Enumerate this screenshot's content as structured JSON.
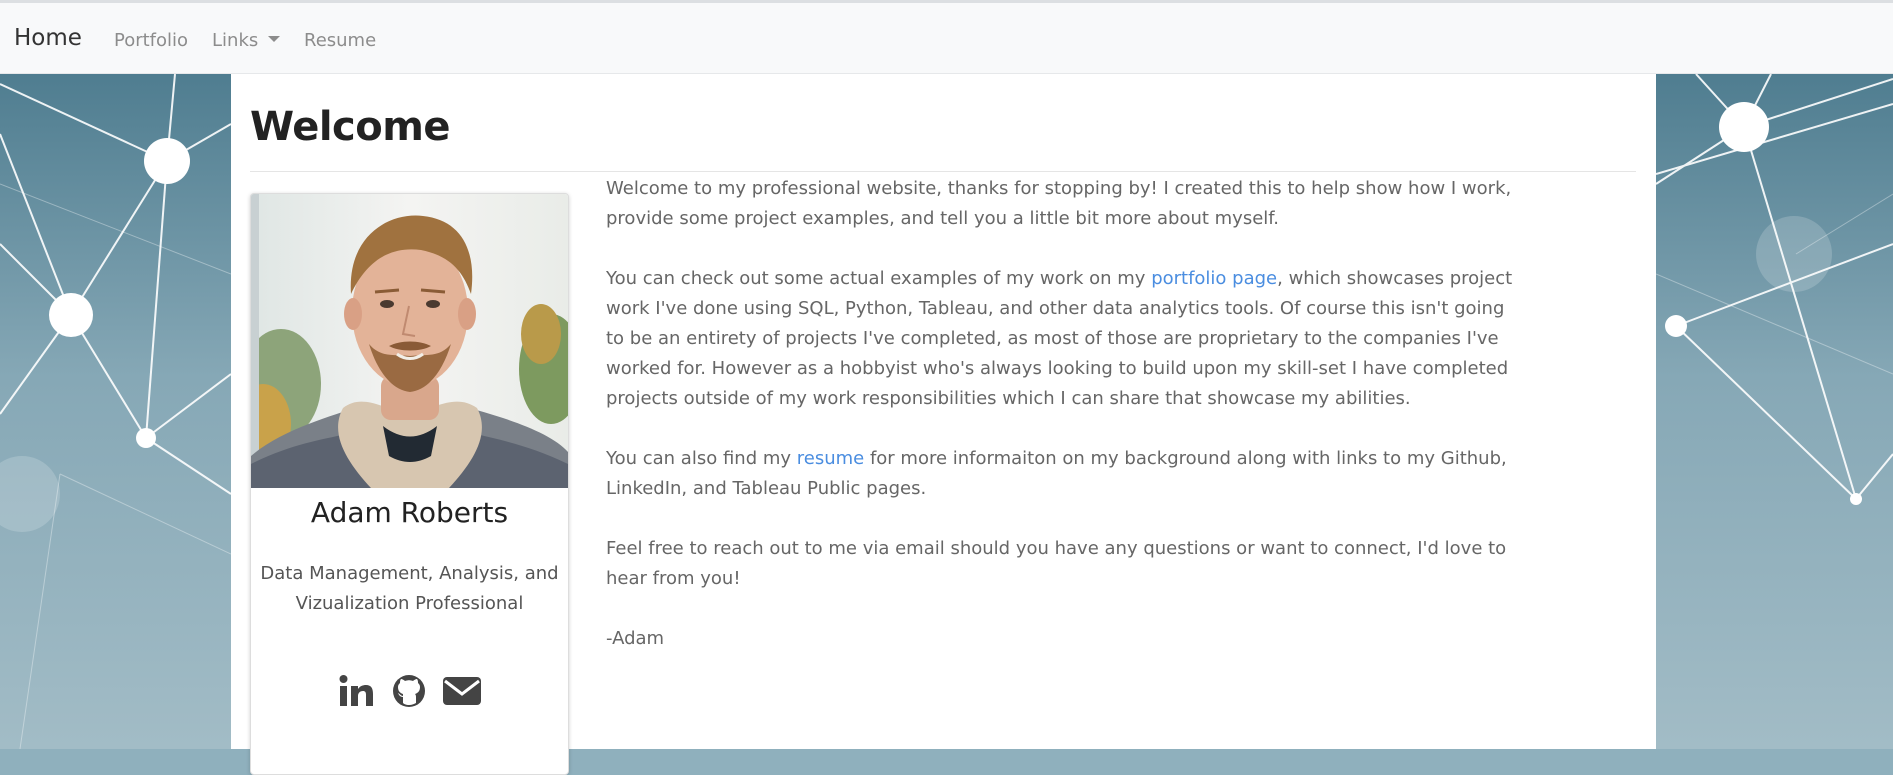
{
  "navbar": {
    "brand": "Home",
    "items": [
      {
        "label": "Portfolio"
      },
      {
        "label": "Links"
      },
      {
        "label": "Resume"
      }
    ]
  },
  "main": {
    "heading": "Welcome",
    "profile": {
      "name": "Adam Roberts",
      "title": "Data Management, Analysis, and Vizualization Professional",
      "social_icons": [
        "linkedin-icon",
        "github-icon",
        "envelope-icon"
      ]
    },
    "paragraphs": {
      "p1": "Welcome to my professional website, thanks for stopping by! I created this to help show how I work, provide some project examples, and tell you a little bit more about myself.",
      "p2_before": "You can check out some actual examples of my work on my ",
      "p2_link": "portfolio page",
      "p2_after": ", which showcases project work I've done using SQL, Python, Tableau, and other data analytics tools. Of course this isn't going to be an entirety of projects I've completed, as most of those are proprietary to the companies I've worked for. However as a hobbyist who's always looking to build upon my skill-set I have completed projects outside of my work responsibilities which I can share that showcase my abilities.",
      "p3_before": "You can also find my ",
      "p3_link": "resume",
      "p3_after": " for more informaiton on my background along with links to my Github, LinkedIn, and Tableau Public pages.",
      "p4": "Feel free to reach out to me via email should you have any questions or want to connect, I'd love to hear from you!",
      "signoff": "-Adam"
    }
  },
  "colors": {
    "link": "#4a8de0",
    "background_network": "#6f96a5",
    "text": "#666666"
  }
}
